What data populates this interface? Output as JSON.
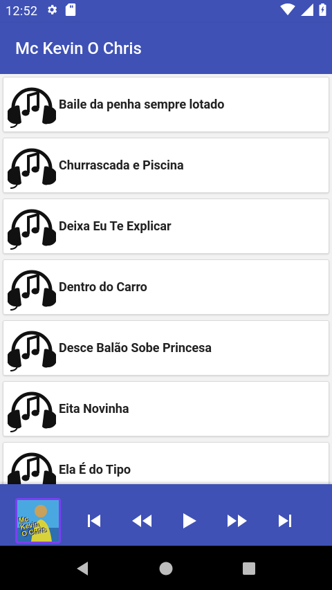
{
  "status_bar": {
    "time": "12:52",
    "left_icons": [
      "gear-icon",
      "sd-card-icon"
    ],
    "right_icons": [
      "wifi-icon",
      "cell-signal-icon",
      "battery-icon"
    ]
  },
  "app_bar": {
    "title": "Mc Kevin O Chris"
  },
  "songs": [
    {
      "title": "Baile da penha sempre lotado",
      "icon": "headphones-music-icon"
    },
    {
      "title": "Churrascada e Piscina",
      "icon": "headphones-music-icon"
    },
    {
      "title": "Deixa Eu Te Explicar",
      "icon": "headphones-music-icon"
    },
    {
      "title": "Dentro do Carro",
      "icon": "headphones-music-icon"
    },
    {
      "title": "Desce Balão Sobe Princesa",
      "icon": "headphones-music-icon"
    },
    {
      "title": "Eita Novinha",
      "icon": "headphones-music-icon"
    },
    {
      "title": "Ela É do Tipo",
      "icon": "headphones-music-icon"
    }
  ],
  "player": {
    "album_art_text": [
      "Mc",
      "Kevin",
      "O Chris"
    ],
    "controls": [
      "skip-previous-icon",
      "rewind-icon",
      "play-icon",
      "fast-forward-icon",
      "skip-next-icon"
    ]
  },
  "nav_bar": {
    "buttons": [
      "back-triangle-icon",
      "home-circle-icon",
      "recents-square-icon"
    ]
  },
  "colors": {
    "primary": "#3f51b5",
    "album_border": "#7b3ff2",
    "nav_bar": "#000000",
    "song_text": "#212121"
  }
}
